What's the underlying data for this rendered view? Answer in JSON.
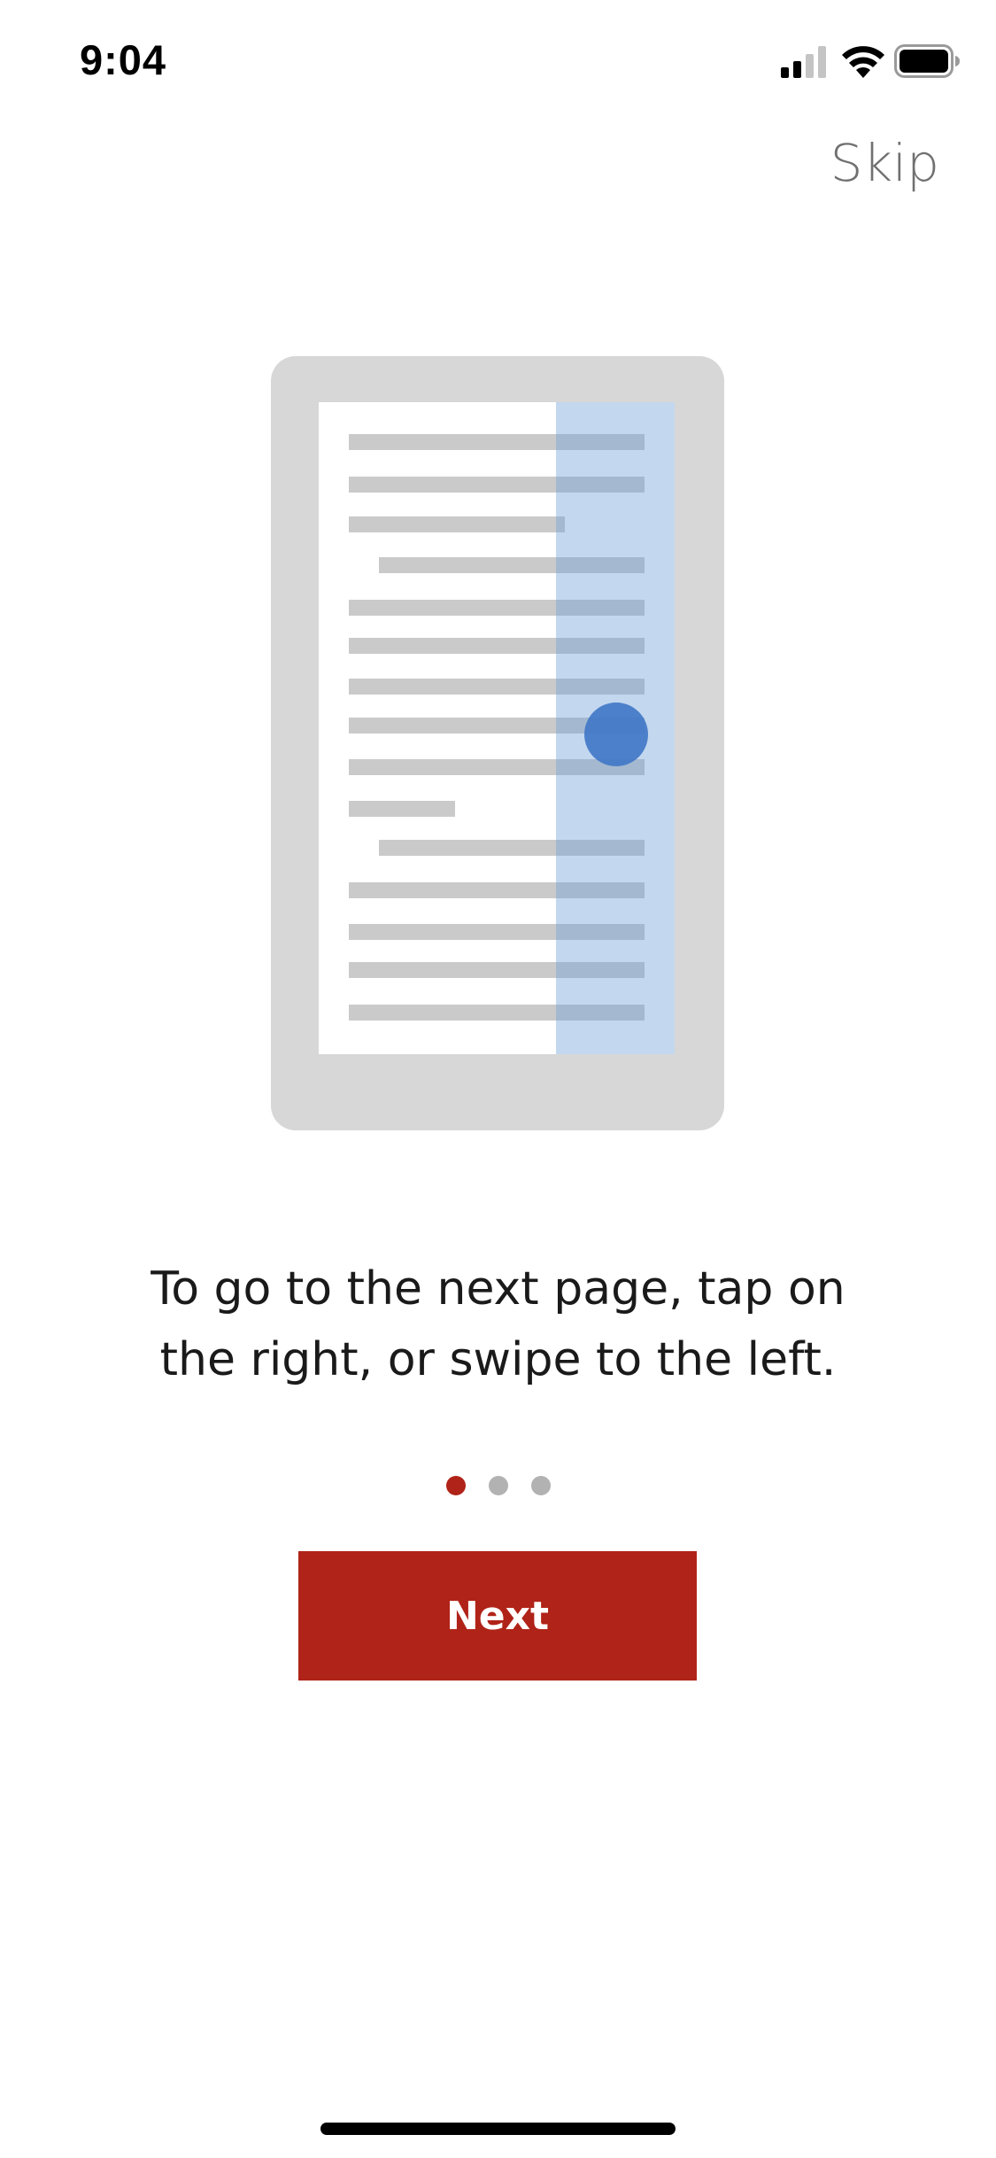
{
  "status_bar": {
    "time": "9:04",
    "signal_icon": "cellular-signal-icon",
    "wifi_icon": "wifi-icon",
    "battery_icon": "battery-icon"
  },
  "header": {
    "skip_label": "Skip"
  },
  "illustration": {
    "icon": "tap-right-page-turn-illustration",
    "tap_zone_color": "#c2d5ea",
    "touch_point_color": "#4a7fc8"
  },
  "onboarding": {
    "caption": "To go to the next page, tap on\nthe right, or swipe to the left.",
    "pagination": {
      "total": 3,
      "current": 1
    },
    "next_label": "Next"
  },
  "colors": {
    "accent": "#b02318",
    "inactive_dot": "#b2b2b2",
    "skip_text": "#707070"
  }
}
